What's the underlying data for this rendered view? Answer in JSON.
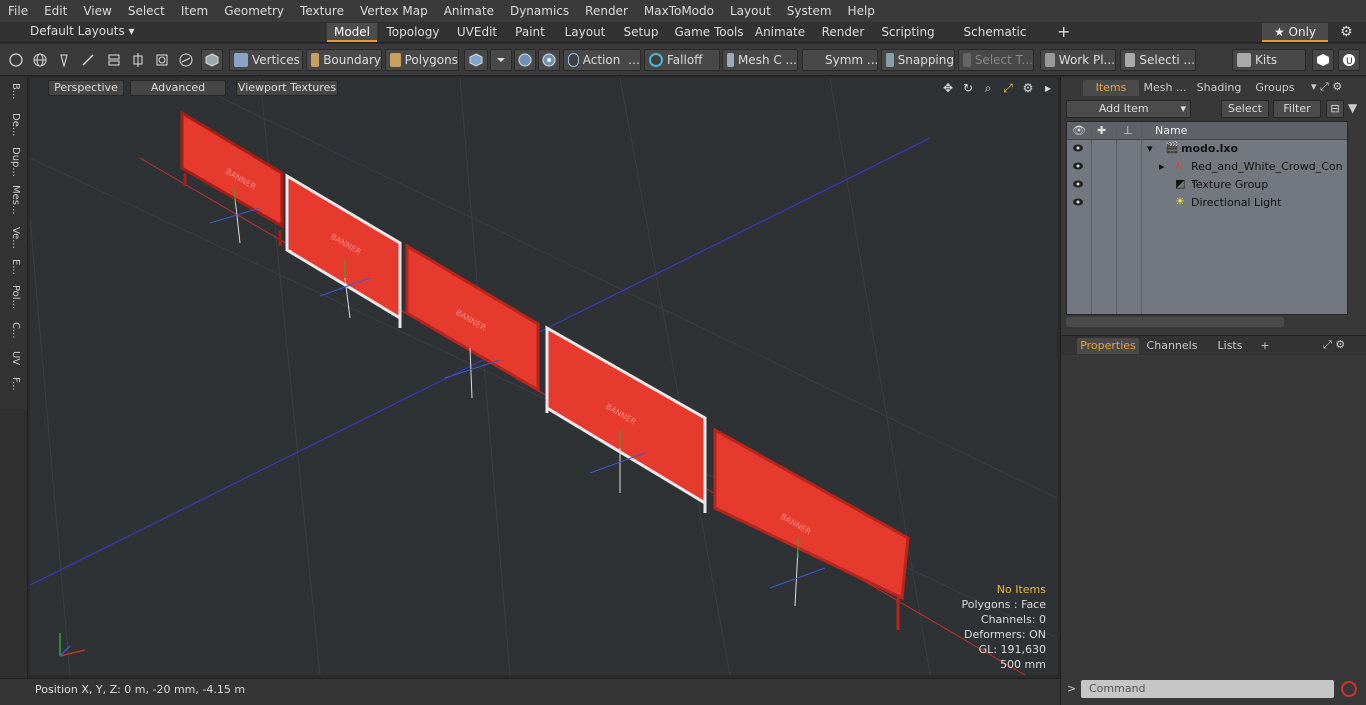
{
  "menu": [
    "File",
    "Edit",
    "View",
    "Select",
    "Item",
    "Geometry",
    "Texture",
    "Vertex Map",
    "Animate",
    "Dynamics",
    "Render",
    "MaxToModo",
    "Layout",
    "System",
    "Help"
  ],
  "layout": {
    "default_label": "Default Layouts ▾",
    "tabs": [
      "Model",
      "Topology",
      "UVEdit",
      "Paint",
      "Layout",
      "Setup",
      "Game Tools",
      "Animate",
      "Render",
      "Scripting",
      "Schematic Fusion"
    ],
    "active_tab": "Model",
    "only_label": "★ Only"
  },
  "toolbar": {
    "vertices": "Vertices",
    "boundary": "Boundary",
    "polygons": "Polygons",
    "action": "Action",
    "falloff": "Falloff",
    "mesh": "Mesh C ...",
    "symm": "Symm ...",
    "snapping": "Snapping",
    "select_t": "Select T...",
    "workpl": "Work Pl...",
    "selecti": "Selecti ...",
    "kits": "Kits"
  },
  "lefttabs": [
    "B...",
    "De...",
    "Dup...",
    "Mes...",
    "Ve...",
    "E...",
    "Pol...",
    "C...",
    "UV",
    "F..."
  ],
  "viewport": {
    "perspective": "Perspective",
    "advanced": "Advanced",
    "textures": "Viewport Textures",
    "stats": {
      "items": "No Items",
      "polygons": "Polygons : Face",
      "channels": "Channels: 0",
      "deformers": "Deformers: ON",
      "gl": "GL: 191,630",
      "scale": "500 mm"
    },
    "banner_text": "BANNER"
  },
  "status": {
    "position": "Position X, Y, Z:   0 m, -20 mm, -4.15 m"
  },
  "right": {
    "tabs": [
      "Items",
      "Mesh ...",
      "Shading",
      "Groups"
    ],
    "add_item": "Add Item",
    "select": "Select",
    "filter": "Filter",
    "col_name": "Name",
    "items": [
      "modo.lxo",
      "Red_and_White_Crowd_Con ...",
      "Texture Group",
      "Directional Light"
    ],
    "lower_tabs": [
      "Properties",
      "Channels",
      "Lists"
    ],
    "command_placeholder": "Command"
  },
  "colors": {
    "accent": "#e89a2c",
    "banner": "#e63a2f",
    "frame_red": "#b7251d",
    "frame_white": "#e8e8e8"
  }
}
